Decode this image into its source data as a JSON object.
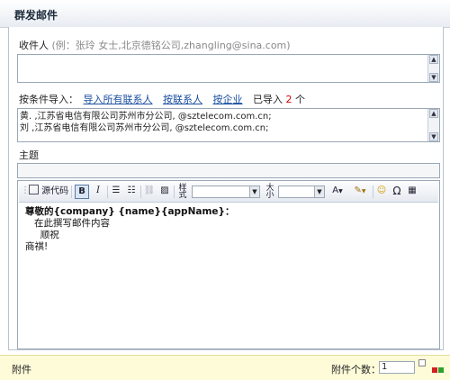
{
  "title": "群发邮件",
  "recipients": {
    "label": "收件人",
    "hint": "(例：张玲 女士,北京德铭公司,zhangling@sina.com)"
  },
  "import": {
    "label": "按条件导入：",
    "links": [
      "导入所有联系人",
      "按联系人",
      "按企业"
    ],
    "imported_label": "已导入",
    "imported_count": "2",
    "imported_unit": "个"
  },
  "imported_list": [
    "黄. ,江苏省电信有限公司苏州市分公司, @sztelecom.com.cn;",
    "刘  ,江苏省电信有限公司苏州市分公司, @sztelecom.com.cn;"
  ],
  "subject": {
    "label": "主题",
    "value": ""
  },
  "editor": {
    "source_label": "源代码",
    "style_label": "样式",
    "size_label": "大小",
    "bold": "B",
    "italic": "I",
    "omega": "Ω",
    "body_lines": [
      "尊敬的{company} {name}{appName}：",
      "   在此撰写邮件内容",
      "     顺祝",
      "商祺!"
    ]
  },
  "attachments": {
    "label": "附件",
    "count_label": "附件个数：",
    "count_value": "1"
  }
}
